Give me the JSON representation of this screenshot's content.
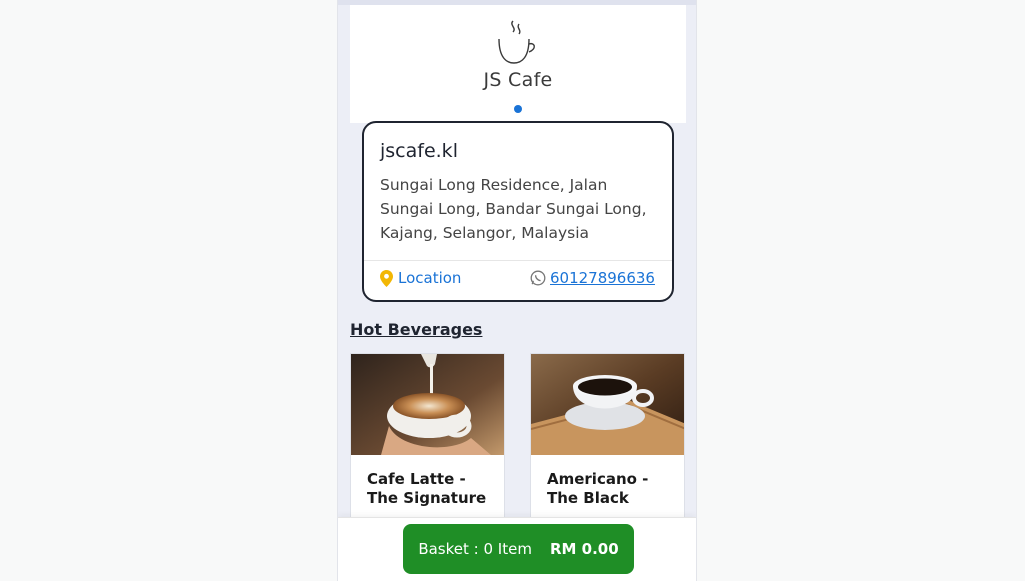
{
  "brand": {
    "name": "JS Cafe"
  },
  "store": {
    "handle": "jscafe.kl",
    "address": "Sungai Long Residence, Jalan Sungai Long, Bandar Sungai Long, Kajang, Selangor, Malaysia",
    "location_label": "Location",
    "phone": "60127896636",
    "icons": {
      "location": "map-pin-icon",
      "phone": "whatsapp-icon"
    },
    "colors": {
      "location_icon": "#f2b705",
      "link": "#1a73d6"
    }
  },
  "menu": {
    "section_title": "Hot Beverages",
    "products": [
      {
        "name": "Cafe Latte - The Signature"
      },
      {
        "name": "Americano - The Black"
      }
    ]
  },
  "basket": {
    "label": "Basket : 0 Item",
    "total": "RM 0.00",
    "color": "#1f8e26"
  }
}
